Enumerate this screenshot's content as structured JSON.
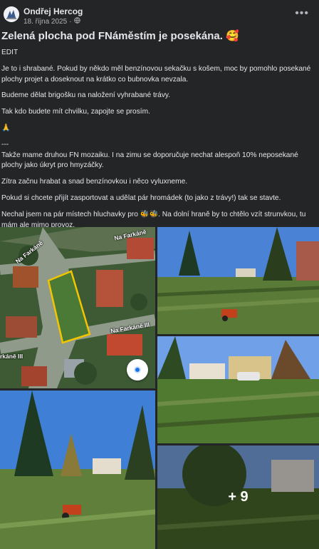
{
  "post": {
    "author": "Ondřej Hercog",
    "date": "18. října 2025",
    "title": "Zelená plocha pod FNáměstím je posekána. 🥰",
    "body": [
      "EDIT",
      "Je to i shrabané. Pokud by někdo měl benzínovou sekačku s košem, moc by pomohlo posekané plochy projet a doseknout na krátko co bubnovka nevzala.",
      "Budeme dělat brigošku na naložení vyhrabané trávy.",
      "Tak kdo budete mít chvilku, zapojte se prosím.",
      "🙏",
      "---",
      "Takže mame druhou FN mozaiku. I na zimu se doporučuje nechat alespoň 10% neposekané plochy jako úkryt pro hmyzáčky.",
      "Zítra začnu hrabat a snad benzínovkou i něco vyluxneme.",
      "Pokud si chcete přijít zasportovat a udělat pár hromádek (to jako z trávy!) tak se stavte.",
      "Nechal jsem na pár místech hluchavky pro 🐝🐝. Na dolní hraně by to chtělo vzít strunvkou, tu mám ale mimo provoz.",
      "🙏"
    ]
  },
  "photos": {
    "more_count": "+ 9",
    "map_streets": [
      "Na Farkáně",
      "Na Farkáně",
      "Na Farkáně III",
      "rkáně III"
    ]
  },
  "icons": [
    "avatar",
    "globe-icon",
    "more-options-icon",
    "location-icon"
  ],
  "colors": {
    "background": "#242526",
    "text": "#e4e6eb",
    "secondary": "#b0b3b8",
    "highlight": "#f2c500"
  }
}
